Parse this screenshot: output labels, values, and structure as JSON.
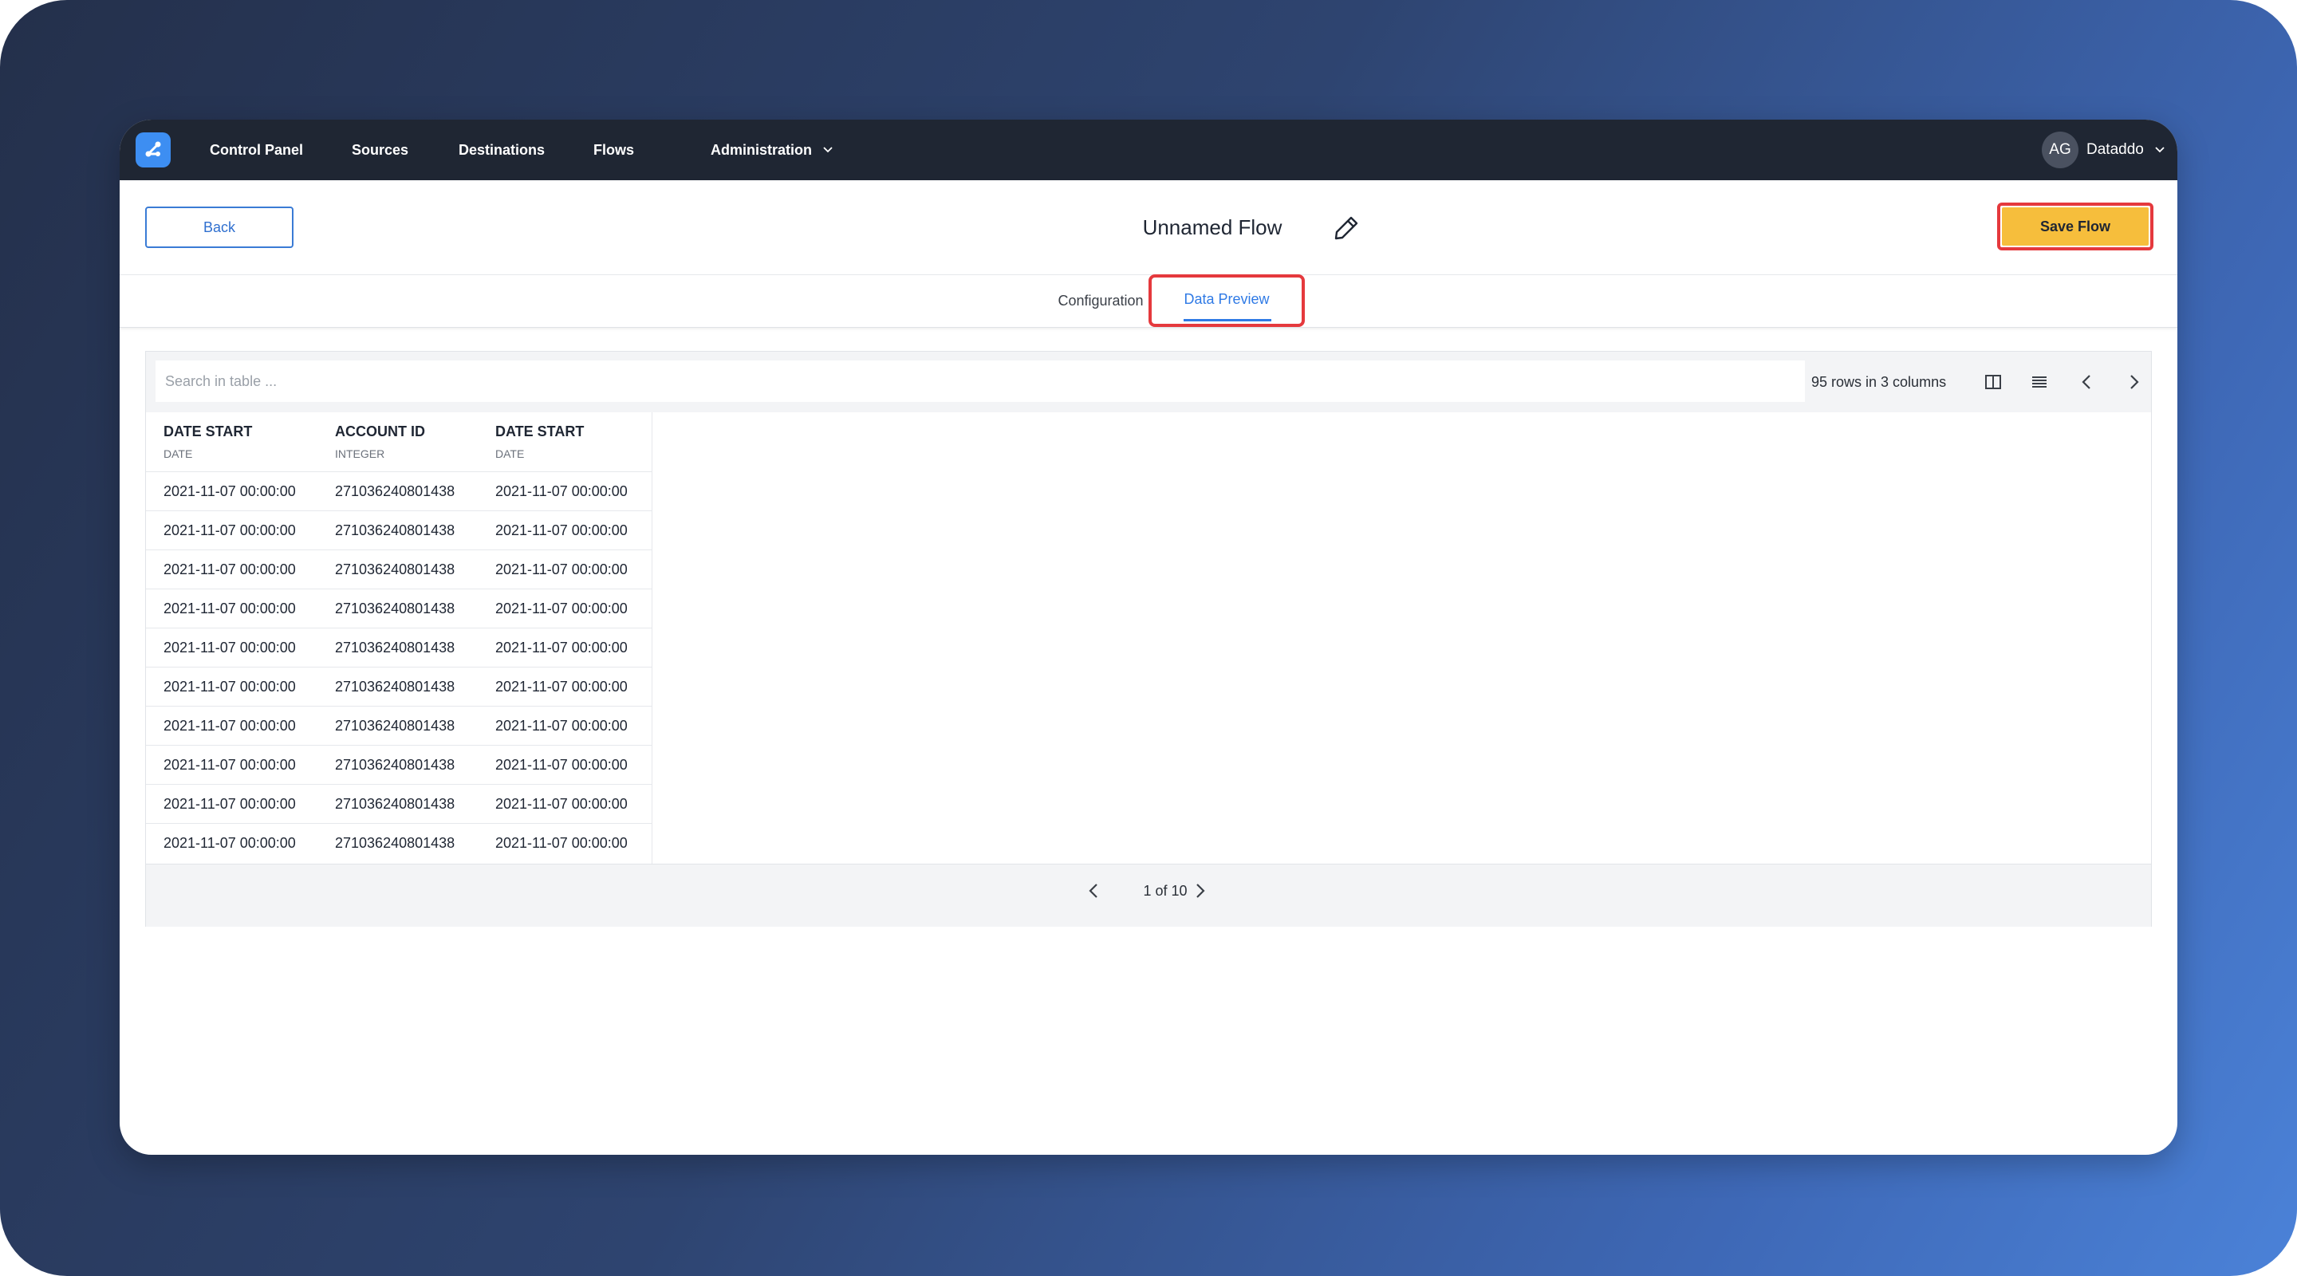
{
  "nav": {
    "items": [
      "Control Panel",
      "Sources",
      "Destinations",
      "Flows"
    ],
    "administration": "Administration",
    "user_initials": "AG",
    "user_name": "Dataddo"
  },
  "header": {
    "back_label": "Back",
    "title": "Unnamed Flow",
    "save_label": "Save Flow"
  },
  "tabs": {
    "configuration": "Configuration",
    "data_preview": "Data Preview",
    "active": "Data Preview"
  },
  "table": {
    "search_placeholder": "Search in table ...",
    "row_count_text": "95 rows in 3 columns",
    "columns": [
      {
        "name": "DATE START",
        "type": "DATE"
      },
      {
        "name": "ACCOUNT ID",
        "type": "INTEGER"
      },
      {
        "name": "DATE START",
        "type": "DATE"
      }
    ],
    "rows": [
      [
        "2021-11-07 00:00:00",
        "271036240801438",
        "2021-11-07 00:00:00"
      ],
      [
        "2021-11-07 00:00:00",
        "271036240801438",
        "2021-11-07 00:00:00"
      ],
      [
        "2021-11-07 00:00:00",
        "271036240801438",
        "2021-11-07 00:00:00"
      ],
      [
        "2021-11-07 00:00:00",
        "271036240801438",
        "2021-11-07 00:00:00"
      ],
      [
        "2021-11-07 00:00:00",
        "271036240801438",
        "2021-11-07 00:00:00"
      ],
      [
        "2021-11-07 00:00:00",
        "271036240801438",
        "2021-11-07 00:00:00"
      ],
      [
        "2021-11-07 00:00:00",
        "271036240801438",
        "2021-11-07 00:00:00"
      ],
      [
        "2021-11-07 00:00:00",
        "271036240801438",
        "2021-11-07 00:00:00"
      ],
      [
        "2021-11-07 00:00:00",
        "271036240801438",
        "2021-11-07 00:00:00"
      ],
      [
        "2021-11-07 00:00:00",
        "271036240801438",
        "2021-11-07 00:00:00"
      ]
    ],
    "pagination": "1 of 10"
  },
  "colors": {
    "navbar": "#1f2633",
    "accent": "#2f7ae5",
    "save_button": "#f6be3c",
    "highlight": "#e5393d"
  },
  "icons": [
    "logo-icon",
    "chevron-down-icon",
    "edit-pencil-icon",
    "columns-icon",
    "list-icon",
    "chevron-left-icon",
    "chevron-right-icon"
  ]
}
